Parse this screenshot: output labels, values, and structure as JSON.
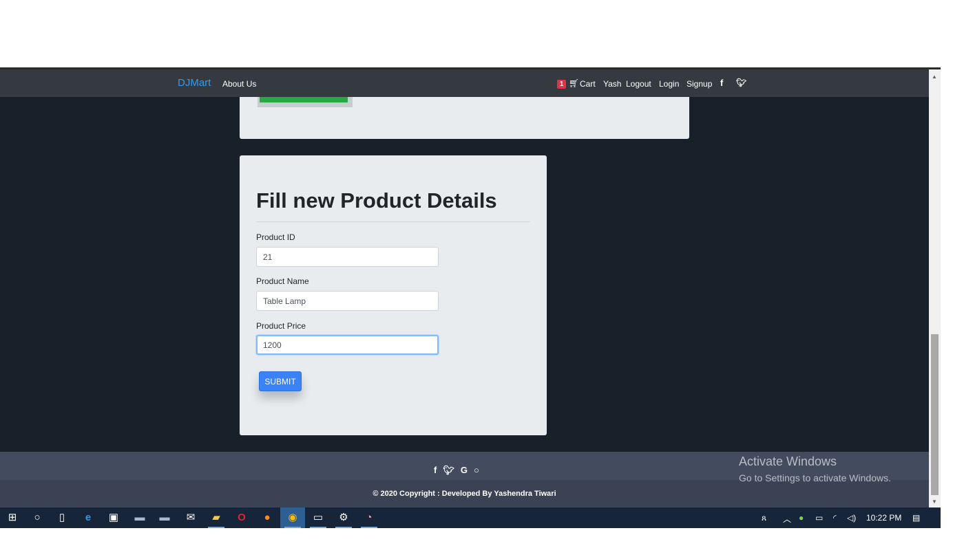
{
  "navbar": {
    "brand": "DJMart",
    "about": "About Us",
    "cart_count": "1",
    "cart_label": "Cart",
    "user": "Yash",
    "logout": "Logout",
    "login": "Login",
    "signup": "Signup",
    "icons": [
      "facebook-icon",
      "twitter-icon"
    ]
  },
  "form": {
    "title": "Fill new Product Details",
    "id_label": "Product ID",
    "id_value": "21",
    "name_label": "Product Name",
    "name_value": "Table Lamp",
    "price_label": "Product Price",
    "price_value": "1200",
    "submit": "SUBMIT"
  },
  "footer": {
    "copyright": "© 2020 Copyright : Developed By Yashendra Tiwari",
    "icons": [
      "facebook-icon",
      "twitter-icon",
      "google-icon",
      "github-icon"
    ]
  },
  "watermark": {
    "line1": "Activate Windows",
    "line2": "Go to Settings to activate Windows."
  },
  "taskbar": {
    "time": "10:22 PM"
  },
  "colors": {
    "brand": "#2e9bf0",
    "submit": "#3b82f6",
    "background": "#18202a",
    "navbar": "#343a40"
  }
}
